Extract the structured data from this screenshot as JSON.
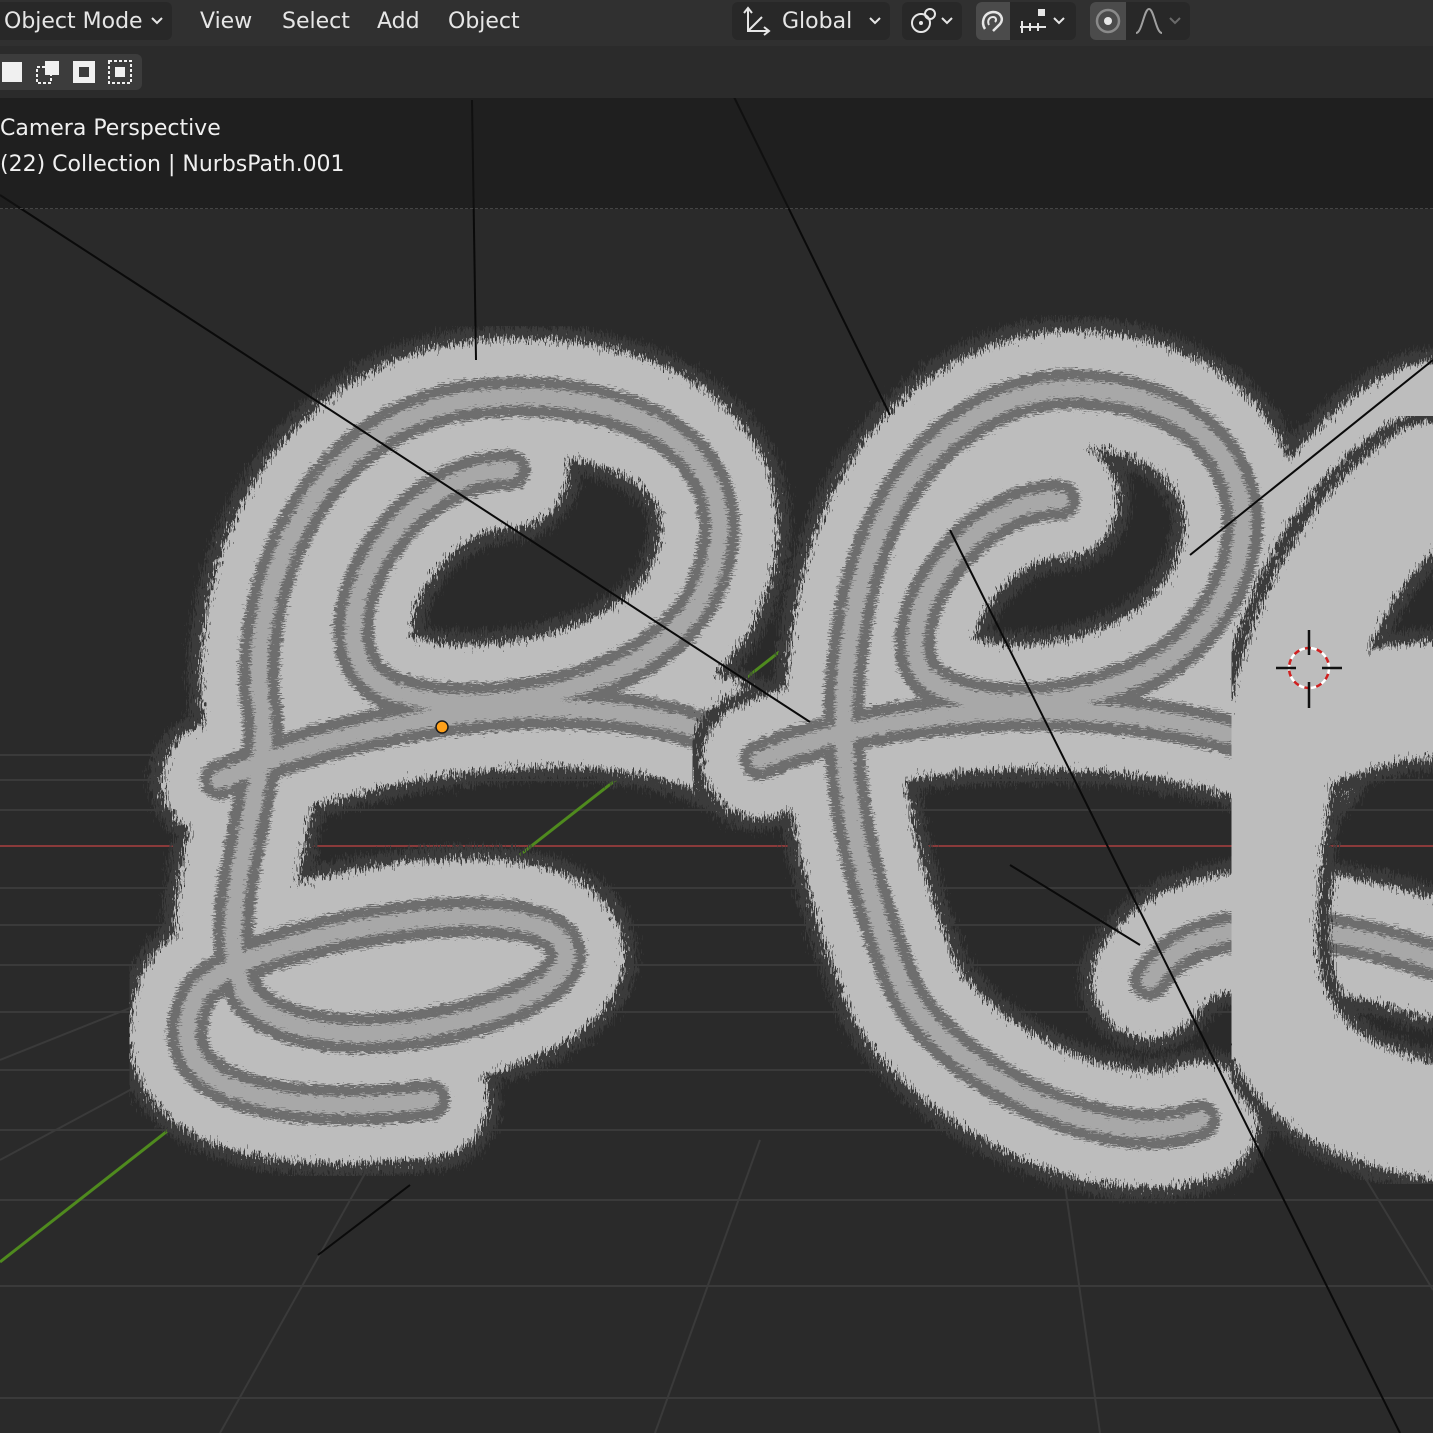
{
  "header": {
    "mode_label": "Object Mode",
    "menus": [
      "View",
      "Select",
      "Add",
      "Object"
    ],
    "orientation_label": "Global"
  },
  "viewport": {
    "view_name": "Camera Perspective",
    "collection_info": "(22) Collection | NurbsPath.001"
  },
  "icons": {
    "orientation": "transform-orientation-icon",
    "pivot": "pivot-point-icon",
    "snap": "snap-magnet-icon",
    "snap_target": "snap-increment-icon",
    "proportional": "proportional-editing-icon",
    "falloff": "falloff-curve-icon",
    "chevron": "chevron-down-icon",
    "cursor": "3d-cursor-icon",
    "origin": "object-origin-dot"
  },
  "colors": {
    "header_bg": "#303030",
    "viewport_bg": "#2a2a2a",
    "x_axis": "#8a3a3a",
    "y_axis": "#4f8a1e",
    "origin": "#ffa11a",
    "fur_light": "#cfcfcf",
    "fur_dark": "#4a4a4a"
  }
}
